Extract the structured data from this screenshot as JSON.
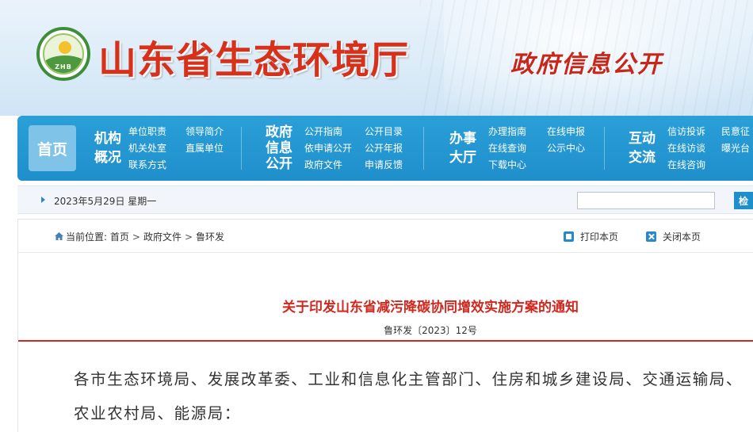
{
  "header": {
    "site_title": "山东省生态环境厅",
    "subtitle": "政府信息公开",
    "logo_text": "ZHB"
  },
  "nav": {
    "home": "首页",
    "groups": [
      {
        "title": [
          "机构",
          "概况"
        ],
        "links": [
          "单位职责",
          "领导简介",
          "机关处室",
          "直属单位",
          "联系方式"
        ]
      },
      {
        "title": [
          "政府",
          "信息",
          "公开"
        ],
        "links": [
          "公开指南",
          "公开目录",
          "依申请公开",
          "公开年报",
          "政府文件",
          "申请反馈"
        ]
      },
      {
        "title": [
          "办事",
          "大厅"
        ],
        "links": [
          "办理指南",
          "在线申报",
          "在线查询",
          "公示中心",
          "下载中心"
        ]
      },
      {
        "title": [
          "互动",
          "交流"
        ],
        "links": [
          "信访投诉",
          "民意征",
          "在线访谈",
          "曝光台",
          "在线咨询"
        ]
      }
    ]
  },
  "datebar": {
    "date": "2023年5月29日 星期一",
    "search_placeholder": "",
    "search_button": "检"
  },
  "breadcrumb": {
    "prefix": "当前位置:",
    "items": [
      "首页",
      "政府文件",
      "鲁环发"
    ],
    "separator": ">"
  },
  "tools": {
    "print": "打印本页",
    "close": "关闭本页"
  },
  "document": {
    "title": "关于印发山东省减污降碳协同增效实施方案的通知",
    "number": "鲁环发〔2023〕12号",
    "body": "各市生态环境局、发展改革委、工业和信息化主管部门、住房和城乡建设局、交通运输局、农业农村局、能源局："
  },
  "colors": {
    "brand_red": "#d0281f",
    "nav_blue": "#1f8fcb",
    "logo_green": "#3d8d3a"
  }
}
